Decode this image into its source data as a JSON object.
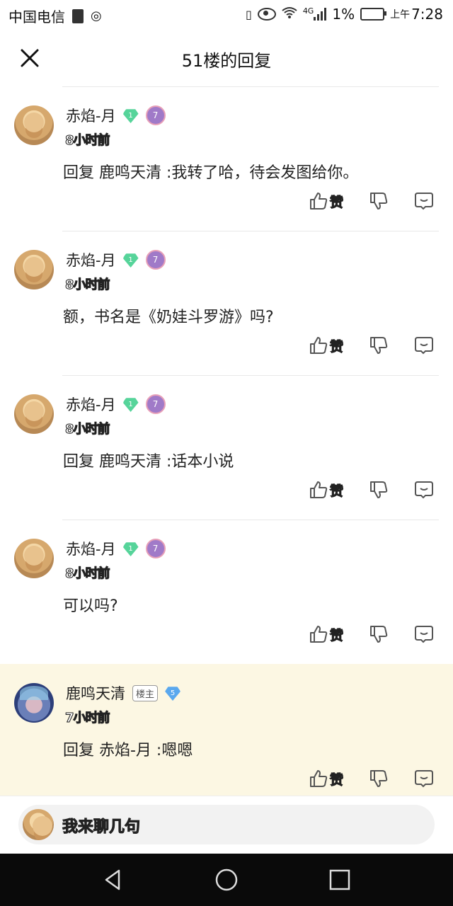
{
  "status_bar": {
    "carrier": "中国电信",
    "network": "4G",
    "battery": "1%",
    "ampm": "上午",
    "time": "7:28"
  },
  "header": {
    "title": "51楼的回复",
    "close_icon": "close-icon"
  },
  "replies": [
    {
      "username": "赤焰-月",
      "level": "1",
      "badge": "7",
      "time": "8小时前",
      "content": "回复 鹿鸣天清  :我转了哈，待会发图给你。",
      "like_label": "赞",
      "host": false
    },
    {
      "username": "赤焰-月",
      "level": "1",
      "badge": "7",
      "time": "8小时前",
      "content": "额，书名是《奶娃斗罗游》吗?",
      "like_label": "赞",
      "host": false
    },
    {
      "username": "赤焰-月",
      "level": "1",
      "badge": "7",
      "time": "8小时前",
      "content": "回复 鹿鸣天清  :话本小说",
      "like_label": "赞",
      "host": false
    },
    {
      "username": "赤焰-月",
      "level": "1",
      "badge": "7",
      "time": "8小时前",
      "content": "可以吗?",
      "like_label": "赞",
      "host": false
    },
    {
      "username": "鹿鸣天清",
      "tag": "楼主",
      "level": "5",
      "time": "7小时前",
      "content": "回复 赤焰-月  :嗯嗯",
      "like_label": "赞",
      "host": true
    }
  ],
  "input_bar": {
    "placeholder": "我来聊几句"
  },
  "colors": {
    "host_bg": "#fcf7e3",
    "green_level": "#56d49a",
    "blue_level": "#5aa8ee",
    "nav_bg": "#0a0a0a"
  }
}
